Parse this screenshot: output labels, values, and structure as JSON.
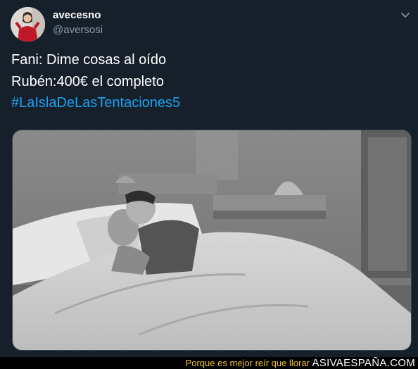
{
  "tweet": {
    "display_name": "avecesno",
    "handle": "@aversosi",
    "lines": [
      "Fani: Dime cosas al oído",
      "Rubén:400€ el completo"
    ],
    "hashtag": "#LaIslaDeLasTentaciones5"
  },
  "footer": {
    "tagline": "Porque es mejor reír que llorar",
    "brand": "ASIVAESPAÑA.COM"
  },
  "colors": {
    "background": "#15202b",
    "link": "#1da1f2",
    "secondary_text": "#8899a6",
    "footer_tagline": "#f2c230"
  },
  "icons": {
    "menu": "chevron-down-icon"
  }
}
